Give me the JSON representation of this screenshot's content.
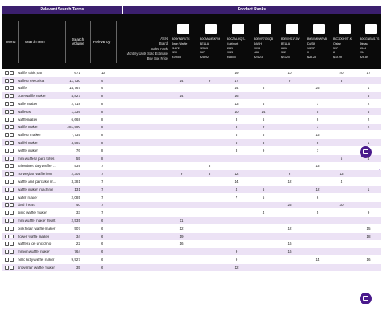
{
  "band": {
    "left_label": "Relevant Search Terms",
    "right_label": "Product Ranks"
  },
  "header": {
    "menu": "Menu",
    "search_term": "Search Term",
    "search_volume": "Search Volume",
    "relevancy": "Relevancy",
    "metric_labels": [
      "ASIN",
      "Brand",
      "Sales Rank",
      "Monthly Units Sold Estimate",
      "Buy Box Price"
    ]
  },
  "products": [
    {
      "asin": "B09YN6R1TC",
      "brand": "Dash Waffle",
      "rank": "11872",
      "units": "120",
      "price": "$19.55"
    },
    {
      "asin": "B0CMAMSKFM",
      "brand": "BELLA",
      "rank": "12513",
      "units": "567",
      "price": "$28.92"
    },
    {
      "asin": "B0CZMLKQ7L",
      "brand": "Cuisinart",
      "rank": "2325",
      "units": "1024",
      "price": "$48.00"
    },
    {
      "asin": "B0BVR7GXQB",
      "brand": "DASH",
      "rank": "1094",
      "units": "486",
      "price": "$24.23"
    },
    {
      "asin": "B0BXNS1FJW",
      "brand": "BELLA",
      "rank": "6601",
      "units": "302",
      "price": "$21.20"
    },
    {
      "asin": "B0BXMDW7VB",
      "brand": "DASH",
      "rank": "10237",
      "units": "0",
      "price": "$28.25"
    },
    {
      "asin": "B0CDKH9T1K",
      "brand": "Ostar",
      "rank": "597",
      "units": "8",
      "price": "$19.99"
    },
    {
      "asin": "B0CGNBM1TS",
      "brand": "Dimau",
      "rank": "8344",
      "units": "134",
      "price": "$26.89"
    }
  ],
  "rows": [
    {
      "term": "waffle stick pan",
      "volume": "671",
      "relevancy": "10",
      "ranks": [
        "",
        "",
        "",
        "19",
        "",
        "10",
        "",
        "40",
        "17"
      ]
    },
    {
      "term": "waflera electrica",
      "volume": "11,730",
      "relevancy": "9",
      "ranks": [
        "",
        "14",
        "9",
        "17",
        "",
        "9",
        "",
        "3",
        ""
      ]
    },
    {
      "term": "waffle",
      "volume": "14,767",
      "relevancy": "9",
      "ranks": [
        "",
        "",
        "",
        "14",
        "8",
        "",
        "25",
        "",
        "1"
      ]
    },
    {
      "term": "cute waffle maker",
      "volume": "4,827",
      "relevancy": "8",
      "ranks": [
        "",
        "14",
        "",
        "16",
        "",
        "",
        "",
        "",
        "6"
      ]
    },
    {
      "term": "wafle maker",
      "volume": "2,718",
      "relevancy": "8",
      "ranks": [
        "",
        "",
        "",
        "13",
        "6",
        "",
        "7",
        "",
        "2"
      ]
    },
    {
      "term": "wafleras",
      "volume": "1,336",
      "relevancy": "8",
      "ranks": [
        "",
        "",
        "",
        "10",
        "14",
        "",
        "5",
        "",
        "6"
      ]
    },
    {
      "term": "wafflemaker",
      "volume": "6,668",
      "relevancy": "8",
      "ranks": [
        "",
        "",
        "",
        "3",
        "6",
        "",
        "8",
        "",
        "2"
      ]
    },
    {
      "term": "waffle maker",
      "volume": "281,990",
      "relevancy": "8",
      "ranks": [
        "",
        "",
        "",
        "3",
        "9",
        "",
        "7",
        "",
        "2"
      ]
    },
    {
      "term": "waflera maker",
      "volume": "7,735",
      "relevancy": "8",
      "ranks": [
        "",
        "",
        "",
        "6",
        "5",
        "",
        "15",
        "",
        ""
      ]
    },
    {
      "term": "waffel maker",
      "volume": "3,593",
      "relevancy": "8",
      "ranks": [
        "",
        "",
        "",
        "5",
        "3",
        "",
        "8",
        "",
        "1"
      ]
    },
    {
      "term": "woffle maker",
      "volume": "76",
      "relevancy": "8",
      "ranks": [
        "",
        "",
        "",
        "3",
        "9",
        "",
        "7",
        "",
        "2"
      ]
    },
    {
      "term": "mini waffera para tofes",
      "volume": "55",
      "relevancy": "8",
      "ranks": [
        "",
        "",
        "",
        "",
        "",
        "",
        "",
        "5",
        "4"
      ]
    },
    {
      "term": "valentines day waffle ...",
      "volume": "539",
      "relevancy": "7",
      "ranks": [
        "",
        "",
        "3",
        "",
        "",
        "",
        "13",
        "",
        ""
      ]
    },
    {
      "term": "norwegian waffle iron",
      "volume": "2,305",
      "relevancy": "7",
      "ranks": [
        "",
        "9",
        "3",
        "12",
        "",
        "6",
        "",
        "13",
        ""
      ]
    },
    {
      "term": "waffle and pancake m...",
      "volume": "3,381",
      "relevancy": "7",
      "ranks": [
        "",
        "",
        "",
        "14",
        "",
        "12",
        "",
        "4",
        ""
      ]
    },
    {
      "term": "waffle maker machine",
      "volume": "131",
      "relevancy": "7",
      "ranks": [
        "",
        "",
        "",
        "4",
        "6",
        "",
        "12",
        "",
        "1"
      ]
    },
    {
      "term": "wafer maker",
      "volume": "2,085",
      "relevancy": "7",
      "ranks": [
        "",
        "",
        "",
        "7",
        "5",
        "",
        "6",
        "",
        ""
      ]
    },
    {
      "term": "dash heart",
      "volume": "40",
      "relevancy": "7",
      "ranks": [
        "",
        "",
        "",
        "",
        "",
        "25",
        "",
        "30",
        ""
      ]
    },
    {
      "term": "simo waffle maker",
      "volume": "33",
      "relevancy": "7",
      "ranks": [
        "",
        "",
        "",
        "",
        "4",
        "",
        "5",
        "",
        "9"
      ]
    },
    {
      "term": "mini waffle maker heart",
      "volume": "2,535",
      "relevancy": "6",
      "ranks": [
        "",
        "11",
        "",
        "",
        "",
        "",
        "",
        "",
        ""
      ]
    },
    {
      "term": "pink heart waffle maker",
      "volume": "507",
      "relevancy": "6",
      "ranks": [
        "",
        "12",
        "",
        "",
        "",
        "12",
        "",
        "",
        "15"
      ]
    },
    {
      "term": "flower waffle maker",
      "volume": "34",
      "relevancy": "6",
      "ranks": [
        "",
        "19",
        "",
        "",
        "",
        "",
        "",
        "",
        "18"
      ]
    },
    {
      "term": "wafflera de unicornio",
      "volume": "22",
      "relevancy": "6",
      "ranks": [
        "",
        "16",
        "",
        "",
        "",
        "16",
        "",
        "",
        ""
      ]
    },
    {
      "term": "minion waffle maker",
      "volume": "764",
      "relevancy": "6",
      "ranks": [
        "",
        "",
        "",
        "9",
        "",
        "16",
        "",
        "",
        ""
      ]
    },
    {
      "term": "hello kitty waffle maker",
      "volume": "9,927",
      "relevancy": "6",
      "ranks": [
        "",
        "",
        "",
        "9",
        "",
        "",
        "14",
        "",
        "16"
      ]
    },
    {
      "term": "snowman waffle maker",
      "volume": "35",
      "relevancy": "6",
      "ranks": [
        "",
        "",
        "",
        "12",
        "",
        "",
        "",
        "",
        ""
      ]
    }
  ]
}
